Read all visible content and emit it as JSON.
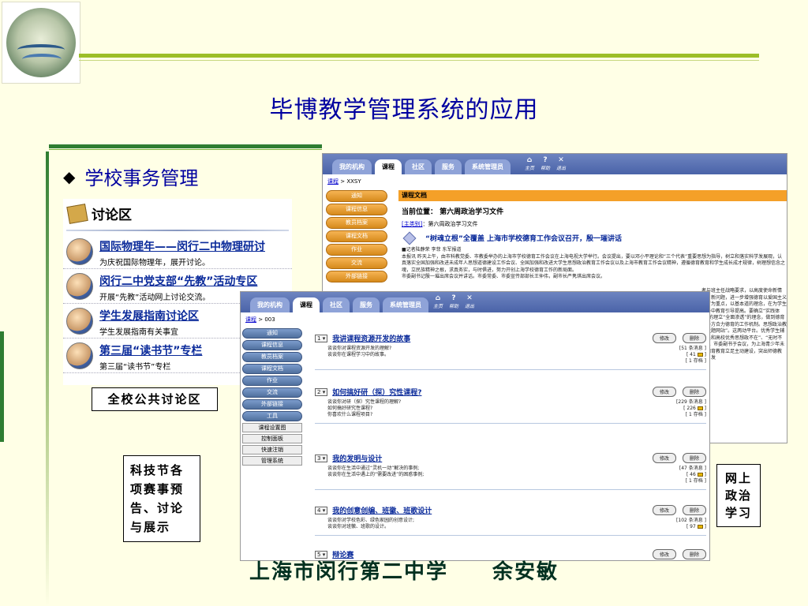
{
  "slide": {
    "title": "毕博教学管理系统的应用",
    "bullet": "学校事务管理",
    "footer_school": "上海市闵行第二中学",
    "footer_author": "余安敏"
  },
  "forum": {
    "heading": "讨论区",
    "items": [
      {
        "title": "国际物理年——闵行二中物理研讨",
        "sub": "为庆祝国际物理年，展开讨论。"
      },
      {
        "title": "闵行二中党支部“先教”活动专区",
        "sub": "开展“先教”活动网上讨论交流。"
      },
      {
        "title": "学生发展指南讨论区",
        "sub": "学生发展指南有关事宜"
      },
      {
        "title": "第三届“读书节”专栏",
        "sub": "第三届“读书节”专栏"
      }
    ]
  },
  "labels": {
    "public_forum": "全校公共讨论区",
    "tech_festival": "科技节各项赛事预告、讨论与展示",
    "online_politics": "网上政治学习"
  },
  "shotA": {
    "tabs": [
      "我的机构",
      "课程",
      "社区",
      "服务",
      "系统管理员"
    ],
    "active_tab": "课程",
    "icons": [
      "主页",
      "帮助",
      "退出"
    ],
    "crumb_link": "课程",
    "crumb_rest": "> XXSY",
    "side": [
      "通知",
      "课程信息",
      "教员档案",
      "课程文档",
      "作业",
      "交流",
      "外部链接"
    ],
    "doc_header": "课程文档",
    "position": "当前位置：  第六周政治学习文件",
    "sub_link": "[主类别]",
    "sub_rest": "：第六周政治学习文件",
    "doc_title": "“树魂立根”全覆盖  上海市学校德育工作会议召开，殷一璀讲话",
    "doc_text": "■记者陆静荣 李菲 东军报道\n本报讯  昨天上午，由市科教党委、市教委举办的上海市学校德育工作会议在上海电视大学举行。会议提出，要以邓小平理论和“三个代表”重要思想为指导，树立和落实科学发展观，认真落实全国加强和改进未成年人思想道德建设工作会议、全国加强和改进大学生思想政治教育工作会议以及上海市教育工作会议精神，遵循德育教育和学生成长成才规律，树理想信念之魂，立民族精神之根，求真务实，与时俱进，努力开创上海学校德育工作的新局面。\n市委副书记殷一璀出席会议并讲话。市委常委、市委宣传部部长王仲伟，副市长严隽琪出席会议。",
    "right_text": "者与班主任战略要求，以高度使命新情况、新问题，进一步增强德育以爱国主义教育为重点，以基本道的理念，在为学生服务中教育引导提高。要确立“实践体验”的理立“全面渗透”的理念，做到德育会各方合力德育的工作机制。思想政治教育主题网站”。这两动平台。优秀学生辅导员和高校优秀思想政不在”、“无时不有”。市委副书于会议，为上海青少年未来德育教育立足主动建设，突出师德教育，发"
  },
  "shotB": {
    "tabs": [
      "我的机构",
      "课程",
      "社区",
      "服务",
      "系统管理员"
    ],
    "active_tab": "课程",
    "icons": [
      "主页",
      "帮助",
      "退出"
    ],
    "crumb_link": "课程",
    "crumb_rest": "> 003",
    "side": [
      "通知",
      "课程信息",
      "教员档案",
      "课程文档",
      "作业",
      "交流",
      "外部链接",
      "工具"
    ],
    "side_plain": [
      "课程设置图",
      "控制面板",
      "快速注销",
      "管理系统"
    ],
    "edit_label": "修改",
    "delete_label": "删除",
    "topics": [
      {
        "num": "1",
        "title": "我讲课程资源开发的故事",
        "desc": [
          "谈谈你对课程资源开发的理解?",
          "谈谈你在课程学习中的故事。"
        ],
        "stats": [
          "[51 条消息 ]",
          "[ 41",
          "[ 1 存档 ]"
        ]
      },
      {
        "num": "2",
        "title": "如何搞好研（探）究性课程?",
        "desc": [
          "谈谈你对研（探）究性课程的理解?",
          "如何搞好研究性课程?",
          "你喜欢什么课程项目?"
        ],
        "stats": [
          "[229 条消息 ]",
          "[ 226",
          "[ 1 存档 ]"
        ]
      },
      {
        "num": "3",
        "title": "我的发明与设计",
        "desc": [
          "谈谈你在生活中通过“灵机一动”解决的事例;",
          "谈谈你在生活中遇上的“需要改进”的困惑事例;"
        ],
        "stats": [
          "[47 条消息 ]",
          "[ 46",
          "[ 1 存档 ]"
        ]
      },
      {
        "num": "4",
        "title": "我的创意创编、班徽、班歌设计",
        "desc": [
          "谈谈你对学校色彩、绿色家园的创意设计;",
          "谈谈你对班徽、班歌的设计。"
        ],
        "stats": [
          "[102 条消息 ]",
          "[ 97"
        ]
      },
      {
        "num": "5",
        "title": "辩论赛",
        "desc": [],
        "stats": []
      }
    ]
  },
  "colors": {
    "title_blue": "#0000a0",
    "accent_green": "#9cbe28",
    "nav_blue": "#4a63a8",
    "button_orange": "#f4a028"
  }
}
